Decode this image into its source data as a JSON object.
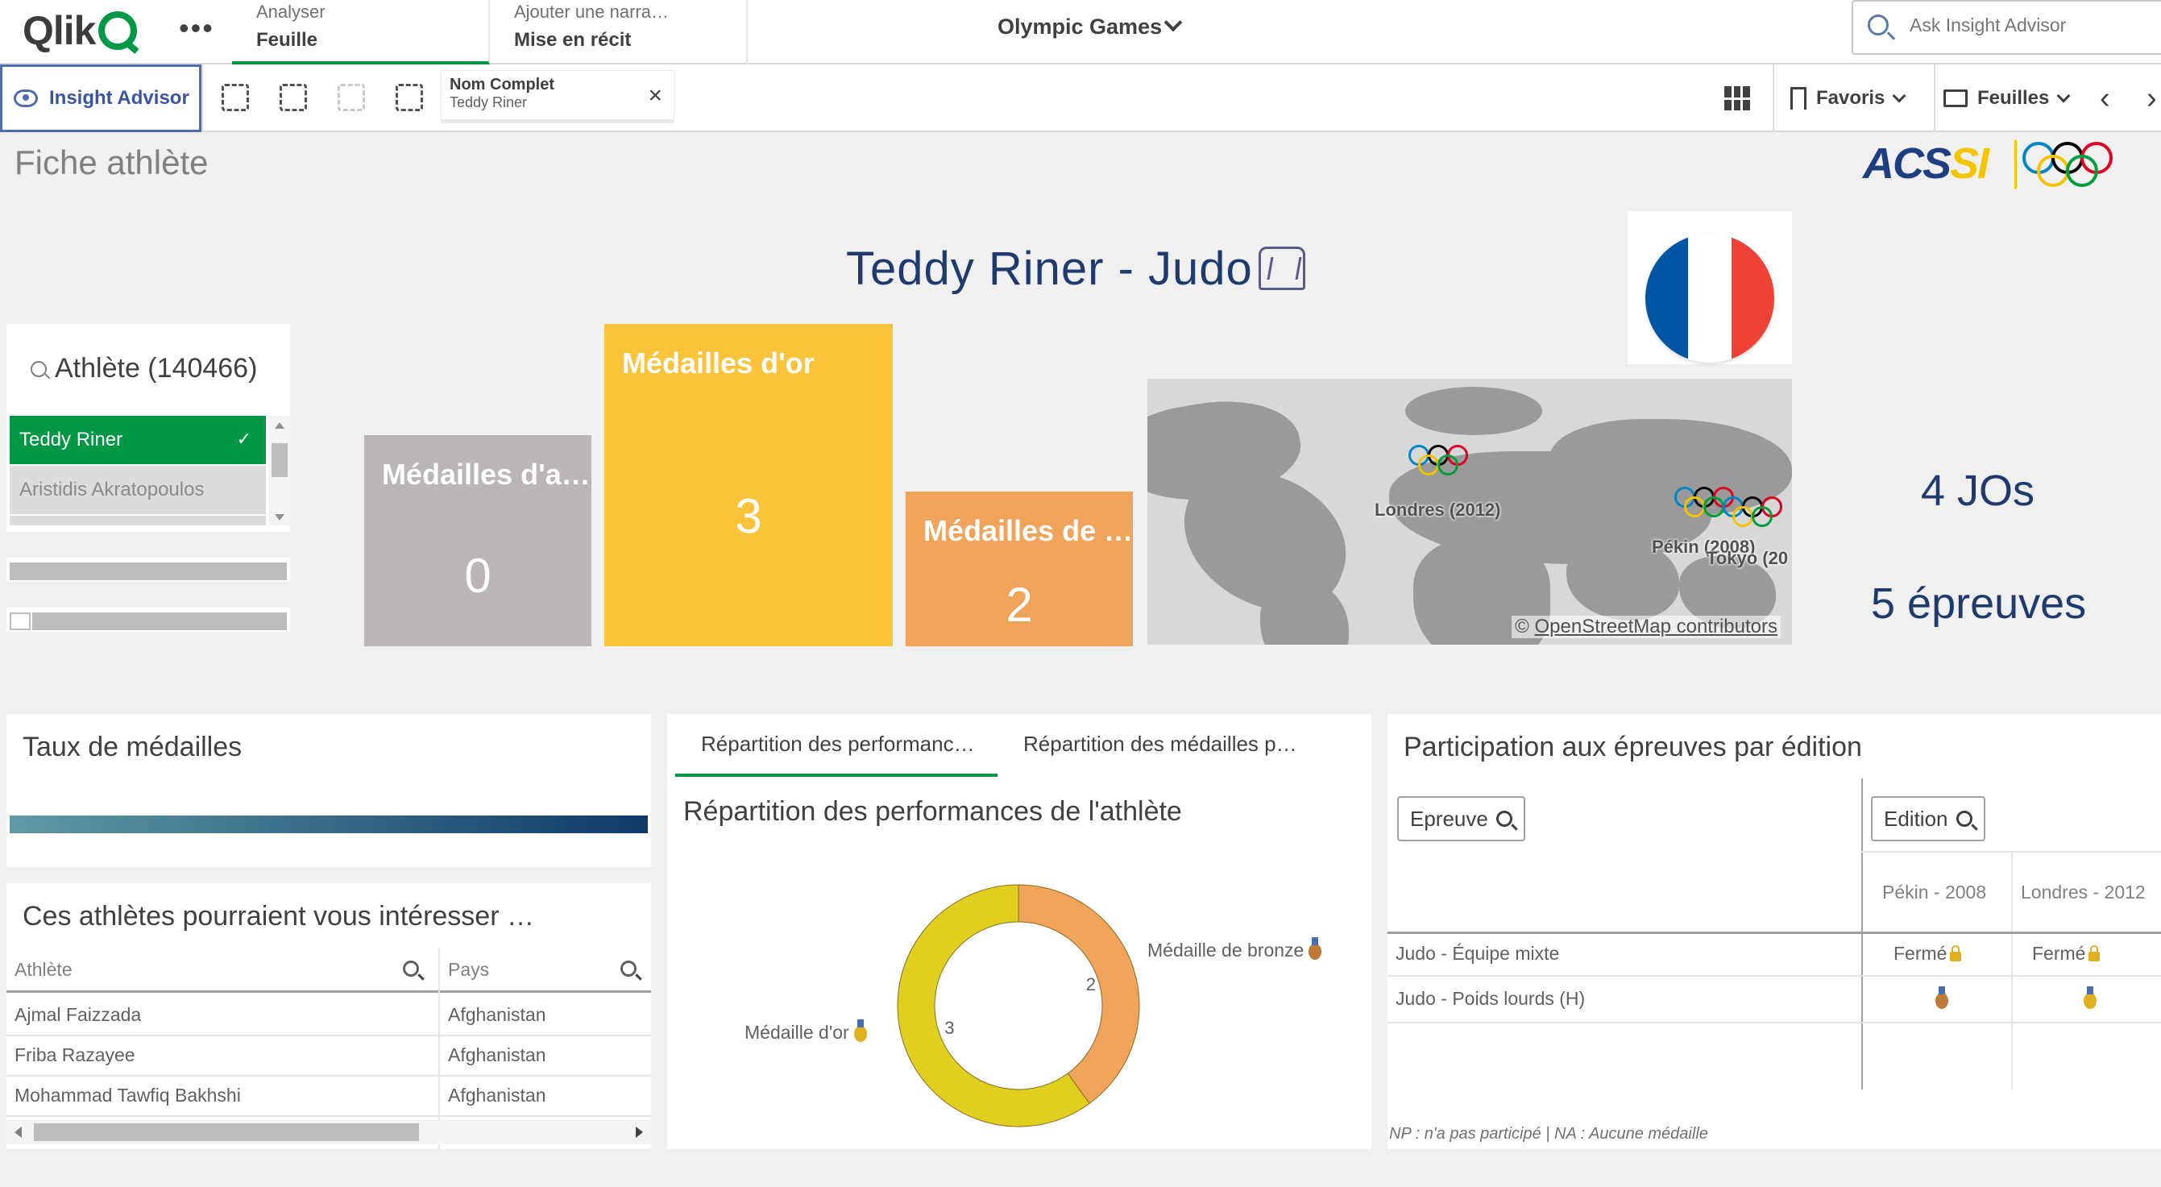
{
  "topbar": {
    "logo": "Qlik",
    "more_label": "•••",
    "tabs": [
      {
        "sub": "Analyser",
        "main": "Feuille"
      },
      {
        "sub": "Ajouter une narra…",
        "main": "Mise en récit"
      }
    ],
    "app_title": "Olympic Games",
    "search_placeholder": "Ask Insight Advisor"
  },
  "toolbar": {
    "insight_label": "Insight Advisor",
    "selection": {
      "field": "Nom Complet",
      "value": "Teddy Riner"
    },
    "favoris_label": "Favoris",
    "feuilles_label": "Feuilles"
  },
  "sheet": {
    "title": "Fiche athlète",
    "logo_text_a": "ACS",
    "logo_text_b": "SI",
    "athlete_title": "Teddy Riner - Judo",
    "flag_colors": [
      "#0055a4",
      "#ffffff",
      "#ef4135"
    ]
  },
  "filter": {
    "title": "Athlète (140466)",
    "selected": "Teddy Riner",
    "tick": "✓",
    "alternative": "Aristidis Akratopoulos"
  },
  "kpis": [
    {
      "label": "Médailles d'a…",
      "value": "0",
      "color": "#b9b5b9"
    },
    {
      "label": "Médailles d'or",
      "value": "3",
      "color": "#fbc33a"
    },
    {
      "label": "Médailles de …",
      "value": "2",
      "color": "#efa459"
    }
  ],
  "map": {
    "markers": [
      {
        "label": "Londres (2012)"
      },
      {
        "label": "Pékin (2008)"
      },
      {
        "label": "Tokyo (20"
      }
    ],
    "attribution_prefix": "© ",
    "attribution": "OpenStreetMap contributors"
  },
  "stats": {
    "jos": "4 JOs",
    "epreuves": "5 épreuves"
  },
  "taux": {
    "title": "Taux de médailles"
  },
  "suggest": {
    "title": "Ces athlètes pourraient vous intéresser …",
    "headers": [
      "Athlète",
      "Pays"
    ],
    "rows": [
      [
        "Ajmal Faizzada",
        "Afghanistan"
      ],
      [
        "Friba Razayee",
        "Afghanistan"
      ],
      [
        "Mohammad Tawfiq Bakhshi",
        "Afghanistan"
      ]
    ]
  },
  "repartition": {
    "tabs": [
      "Répartition des performanc…",
      "Répartition des médailles p…"
    ],
    "chart_title": "Répartition des performances de l'athlète"
  },
  "chart_data": {
    "type": "pie",
    "title": "Répartition des performances de l'athlète",
    "categories": [
      "Médaille d'or",
      "Médaille de bronze"
    ],
    "values": [
      3,
      2
    ],
    "colors": [
      "#e0cf1e",
      "#efa459"
    ],
    "donut": true
  },
  "participation": {
    "title": "Participation aux épreuves par édition",
    "filter_epreuve": "Epreuve",
    "filter_edition": "Edition",
    "columns": [
      "Pékin - 2008",
      "Londres - 2012"
    ],
    "rows": [
      {
        "name": "Judo - Équipe mixte",
        "cells": [
          "Fermé",
          "Fermé"
        ]
      },
      {
        "name": "Judo - Poids lourds (H)",
        "cells": [
          "",
          ""
        ]
      }
    ],
    "note": "NP : n'a pas participé | NA : Aucune médaille"
  },
  "colors": {
    "accent": "#009845",
    "navy": "#1e3a6e",
    "gold": "#fbc33a",
    "bronze": "#efa459",
    "silver": "#b9b5b9"
  }
}
